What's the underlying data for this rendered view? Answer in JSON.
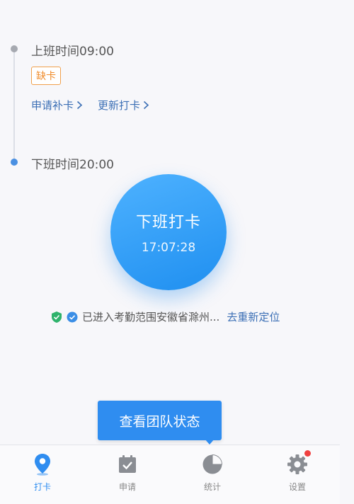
{
  "schedule": {
    "on_duty": {
      "label": "上班时间09:00",
      "status_badge": "缺卡"
    },
    "actions": {
      "apply_makeup": "申请补卡",
      "update_punch": "更新打卡"
    },
    "off_duty": {
      "label": "下班时间20:00"
    }
  },
  "punch_button": {
    "title": "下班打卡",
    "time": "17:07:28"
  },
  "location": {
    "text": "已进入考勤范围安徽省滁州...",
    "relocate_link": "去重新定位"
  },
  "team_status_button": "查看团队状态",
  "tabbar": {
    "items": [
      {
        "label": "打卡",
        "icon": "location-pin-icon",
        "active": true
      },
      {
        "label": "申请",
        "icon": "calendar-check-icon",
        "active": false
      },
      {
        "label": "统计",
        "icon": "pie-chart-icon",
        "active": false
      },
      {
        "label": "设置",
        "icon": "gear-icon",
        "active": false,
        "has_notification": true
      }
    ]
  },
  "colors": {
    "accent": "#2f8df0",
    "link": "#3b6fb5",
    "warning": "#f08c2b",
    "notification": "#f04040"
  }
}
